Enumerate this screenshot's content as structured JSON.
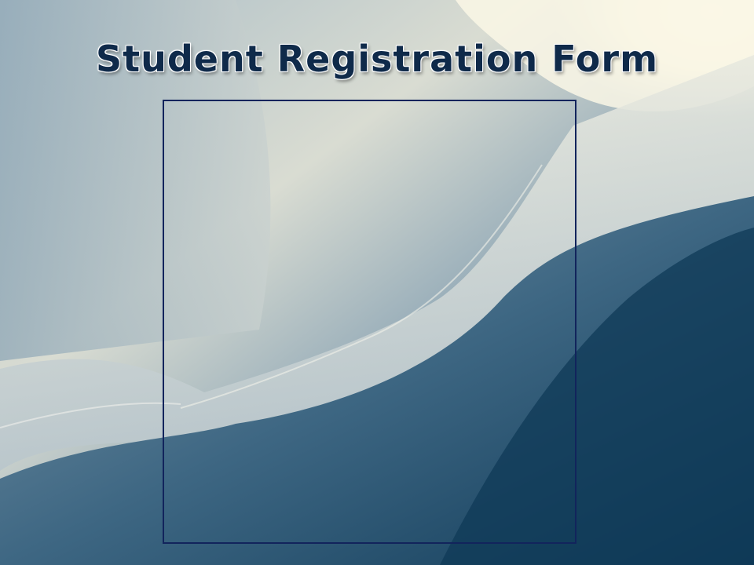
{
  "slide": {
    "title": "Student Registration Form"
  },
  "colors": {
    "title_text": "#0f2a4a",
    "box_border": "#12245c",
    "bg_light": "#f4f1de",
    "bg_dark": "#13405e"
  }
}
